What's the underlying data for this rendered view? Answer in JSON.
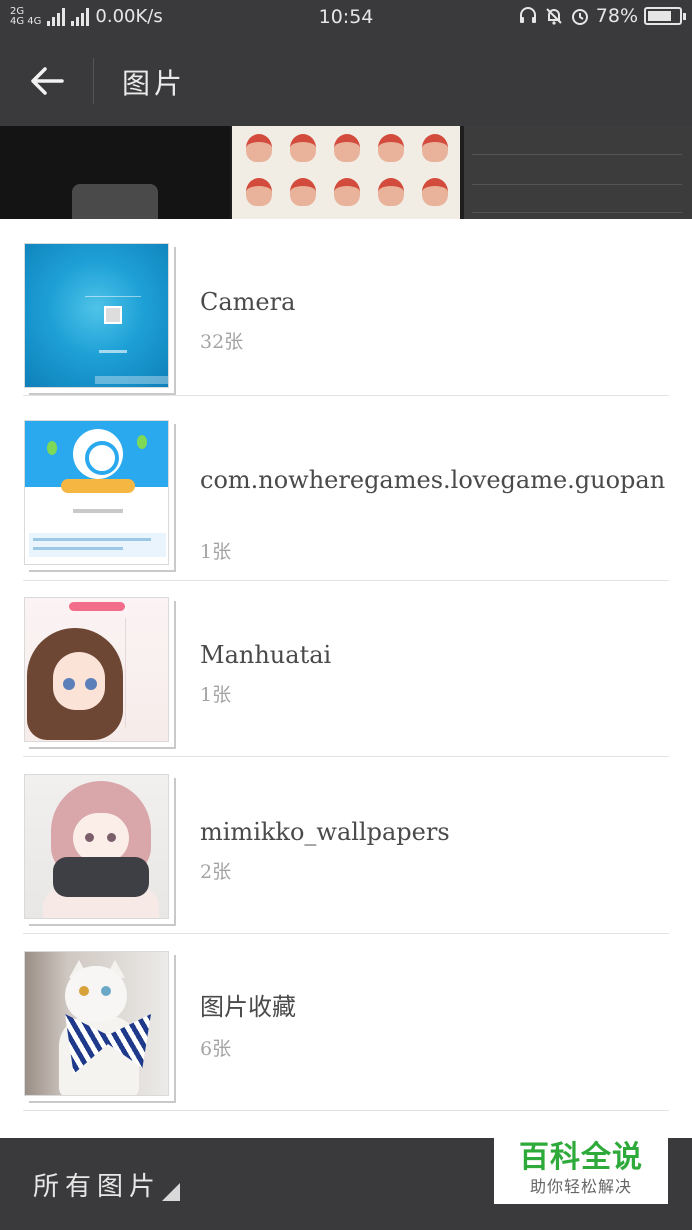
{
  "status_bar": {
    "network_top": "2G",
    "network_second": "4G 4G",
    "speed": "0.00K/s",
    "time": "10:54",
    "battery_percent": "78%",
    "battery_level": 0.78,
    "icons": [
      "headset-icon",
      "alarm-silent-icon",
      "clock-icon",
      "battery-icon"
    ]
  },
  "app_bar": {
    "title": "图片",
    "back_icon": "arrow-left-icon"
  },
  "albums": [
    {
      "name": "Camera",
      "count": "32张",
      "thumb": "camera"
    },
    {
      "name": "com.nowheregames.lovegame.guopan",
      "count": "1张",
      "thumb": "guopan"
    },
    {
      "name": "Manhuatai",
      "count": "1张",
      "thumb": "manhua"
    },
    {
      "name": "mimikko_wallpapers",
      "count": "2张",
      "thumb": "mimikko"
    },
    {
      "name": "图片收藏",
      "count": "6张",
      "thumb": "cat"
    }
  ],
  "bottom_bar": {
    "filter_label": "所有图片"
  },
  "watermark": {
    "main": "百科全说",
    "sub": "助你轻松解决"
  }
}
